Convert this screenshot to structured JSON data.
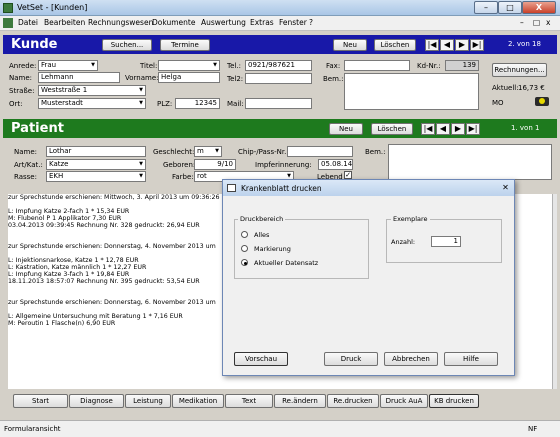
{
  "window": {
    "title": "VetSet - [Kunden]",
    "min": "–",
    "max": "□",
    "close": "X"
  },
  "menu": [
    "Datei",
    "Bearbeiten",
    "Rechnungswesen",
    "Dokumente",
    "Auswertung",
    "Extras",
    "Fenster",
    "?"
  ],
  "kunde": {
    "header": "Kunde",
    "search_btn": "Suchen...",
    "termine_btn": "Termine",
    "new_btn": "Neu",
    "delete_btn": "Löschen",
    "counter": "2. von 18",
    "nav": [
      "|◀",
      "◀",
      "▶",
      "▶|"
    ],
    "labels": {
      "anrede": "Anrede:",
      "titel": "Titel:",
      "name": "Name:",
      "vorname": "Vorname:",
      "strasse": "Straße:",
      "ort": "Ort:",
      "plz": "PLZ:",
      "tel1": "Tel.:",
      "tel2": "Tel2:",
      "mail": "Mail:",
      "fax": "Fax:",
      "bem": "Bem.:",
      "kdnr": "Kd-Nr.:",
      "aktuell": "Aktuell:",
      "mo": "MO"
    },
    "values": {
      "anrede": "Frau",
      "titel": "",
      "name": "Lehmann",
      "vorname": "Helga",
      "strasse": "Weststraße 1",
      "ort": "Musterstadt",
      "plz": "12345",
      "tel1": "0921/987621",
      "tel2": "",
      "mail": "",
      "fax": "",
      "kdnr": "139",
      "aktuell_value": "16,73 €"
    },
    "rechnungen_btn": "Rechnungen..."
  },
  "patient": {
    "header": "Patient",
    "new_btn": "Neu",
    "delete_btn": "Löschen",
    "counter": "1. von 1",
    "nav": [
      "|◀",
      "◀",
      "▶",
      "▶|"
    ],
    "labels": {
      "name": "Name:",
      "art": "Art/Kat.:",
      "rasse": "Rasse:",
      "geschlecht": "Geschlecht:",
      "chip": "Chip-/Pass-Nr.:",
      "geboren": "Geboren:",
      "impf": "Impferinnerung:",
      "farbe": "Farbe:",
      "lebend": "Lebend",
      "bem": "Bem.:"
    },
    "values": {
      "name": "Lothar",
      "art": "Katze",
      "rasse": "EKH",
      "geschlecht": "m",
      "chip": "",
      "geboren": "9/10",
      "impf": "05.08.14",
      "farbe": "rot",
      "lebend": "✓"
    }
  },
  "history": [
    "zur Sprechstunde erschienen: Mittwoch, 3. April 2013 um 09:36:26",
    "",
    "L: Impfung Katze 2-fach  1 * 15,34 EUR",
    "M: Flubenol P  1 Applikator  7,30 EUR",
    "03.04.2013 09:39:45  Rechnung Nr. 328 gedruckt: 26,94 EUR",
    "",
    "",
    "zur Sprechstunde erschienen: Donnerstag, 4. November 2013 um",
    "",
    "L: Injektionsnarkose, Katze  1 * 12,78 EUR",
    "L: Kastration, Katze männlich  1 * 12,27 EUR",
    "L: Impfung Katze 3-fach  1 * 19,84 EUR",
    "18.11.2013 18:57:07  Rechnung Nr. 395 gedruckt: 53,54 EUR",
    "",
    "",
    "zur Sprechstunde erschienen: Donnerstag, 6. November 2013 um",
    "",
    "L: Allgemeine Untersuchung mit Beratung  1 * 7,16 EUR",
    "M: Peroutin  1 Flasche(n)  6,90 EUR"
  ],
  "bottom_buttons": [
    "Start",
    "Diagnose",
    "Leistung",
    "Medikation",
    "Text",
    "Re.ändern",
    "Re.drucken",
    "Druck AuA",
    "KB drucken"
  ],
  "status": {
    "text": "Formularansicht",
    "nf": "NF"
  },
  "dialog": {
    "title": "Krankenblatt drucken",
    "druckbereich": "Druckbereich",
    "options": [
      "Alles",
      "Markierung",
      "Aktueller Datensatz"
    ],
    "selected": 2,
    "exemplare": "Exemplare",
    "anzahl_label": "Anzahl:",
    "anzahl_value": "1",
    "buttons": {
      "vorschau": "Vorschau",
      "druck": "Druck",
      "abbrechen": "Abbrechen",
      "hilfe": "Hilfe"
    }
  },
  "colors": {
    "kunde_header": "#1818a8",
    "patient_header": "#1e7a1e"
  }
}
